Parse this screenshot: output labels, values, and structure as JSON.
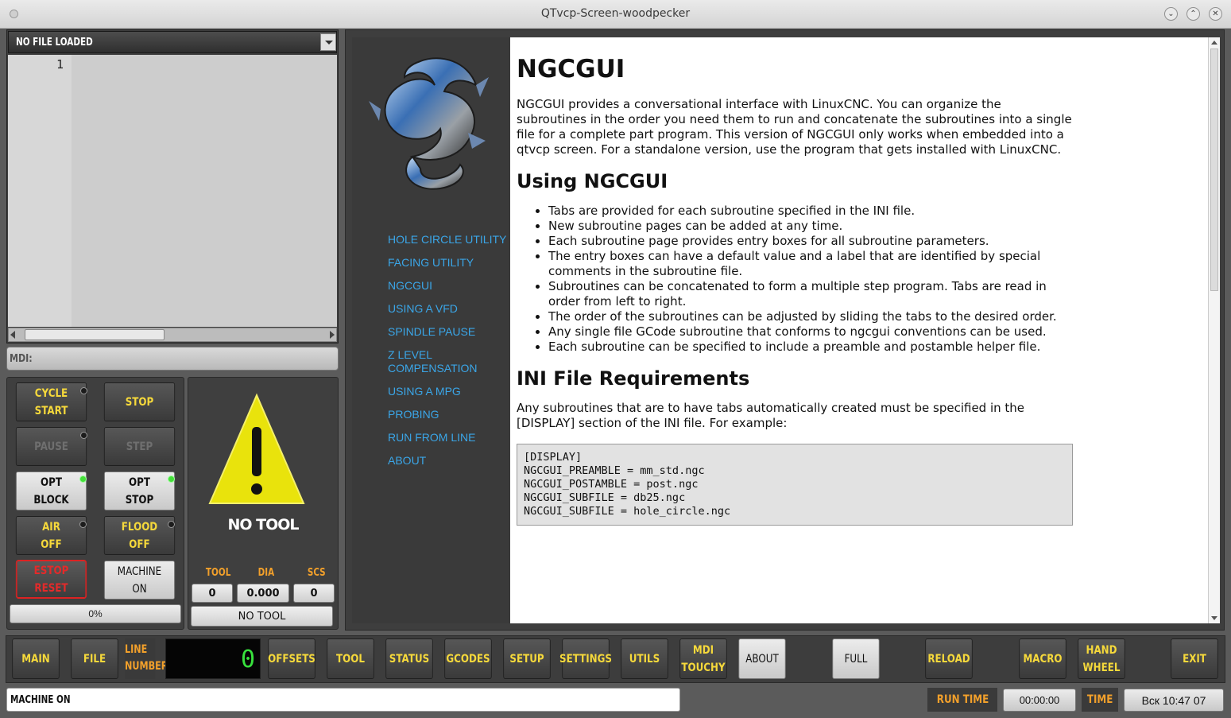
{
  "window": {
    "title": "QTvcp-Screen-woodpecker",
    "controls": [
      "⌄",
      "⌃",
      "✕"
    ]
  },
  "editor": {
    "file_label": "NO FILE LOADED",
    "line_number": "1"
  },
  "mdi": {
    "label": "MDI:"
  },
  "controls": {
    "cycle_start": [
      "CYCLE",
      "START"
    ],
    "stop": "STOP",
    "pause": "PAUSE",
    "step": "STEP",
    "opt_block": [
      "OPT",
      "BLOCK"
    ],
    "opt_stop": [
      "OPT",
      "STOP"
    ],
    "air": [
      "AIR",
      "OFF"
    ],
    "flood": [
      "FLOOD",
      "OFF"
    ],
    "estop": [
      "ESTOP",
      "RESET"
    ],
    "machine": [
      "MACHINE",
      "ON"
    ],
    "progress": "0%",
    "progress_value": 0
  },
  "tool": {
    "status": "NO TOOL",
    "headers": [
      "TOOL",
      "DIA",
      "SCS"
    ],
    "values": [
      "0",
      "0.000",
      "0"
    ],
    "name": "NO TOOL"
  },
  "help_nav": [
    "HOLE CIRCLE UTILITY",
    "FACING UTILITY",
    "NGCGUI",
    "USING A VFD",
    "SPINDLE PAUSE",
    "Z LEVEL COMPENSATION",
    "USING A MPG",
    "PROBING",
    "RUN FROM LINE",
    "ABOUT"
  ],
  "doc": {
    "title": "NGCGUI",
    "intro": "NGCGUI provides a conversational interface with LinuxCNC. You can organize the subroutines in the order you need them to run and concatenate the subroutines into a single file for a complete part program. This version of NGCGUI only works when embedded into a qtvcp screen. For a standalone version, use the program that gets installed with LinuxCNC.",
    "h2_using": "Using NGCGUI",
    "bullets": [
      "Tabs are provided for each subroutine specified in the INI file.",
      "New subroutine pages can be added at any time.",
      "Each subroutine page provides entry boxes for all subroutine parameters.",
      "The entry boxes can have a default value and a label that are identified by special comments in the subroutine file.",
      "Subroutines can be concatenated to form a multiple step program. Tabs are read in order from left to right.",
      "The order of the subroutines can be adjusted by sliding the tabs to the desired order.",
      "Any single file GCode subroutine that conforms to ngcgui conventions can be used.",
      "Each subroutine can be specified to include a preamble and postamble helper file."
    ],
    "h2_ini": "INI File Requirements",
    "ini_text": "Any subroutines that are to have tabs automatically created must be specified in the [DISPLAY] section of the INI file. For example:",
    "code": "[DISPLAY]\nNGCGUI_PREAMBLE = mm_std.ngc\nNGCGUI_POSTAMBLE = post.ngc\nNGCGUI_SUBFILE = db25.ngc\nNGCGUI_SUBFILE = hole_circle.ngc"
  },
  "bottom_tabs": {
    "main": "MAIN",
    "file": "FILE",
    "line_number": [
      "LINE",
      "NUMBER"
    ],
    "line_value": "0",
    "offsets": "OFFSETS",
    "tool": "TOOL",
    "status": "STATUS",
    "gcodes": "GCODES",
    "setup": "SETUP",
    "settings": "SETTINGS",
    "utils": "UTILS",
    "mdi_touchy": [
      "MDI",
      "TOUCHY"
    ],
    "about": "ABOUT",
    "full": "FULL",
    "reload": "RELOAD",
    "macro": "MACRO",
    "hand_wheel": [
      "HAND",
      "WHEEL"
    ],
    "exit": "EXIT"
  },
  "statusbar": {
    "message": "MACHINE ON",
    "run_time_label": "RUN TIME",
    "run_time": "00:00:00",
    "time_label": "TIME",
    "time": "Вск 10:47 07"
  },
  "colors": {
    "accent": "#f6d93b",
    "link": "#3aa6e8",
    "led_on": "#45e03a",
    "estop": "#e42a2a",
    "label_orange": "#f2a02b"
  }
}
